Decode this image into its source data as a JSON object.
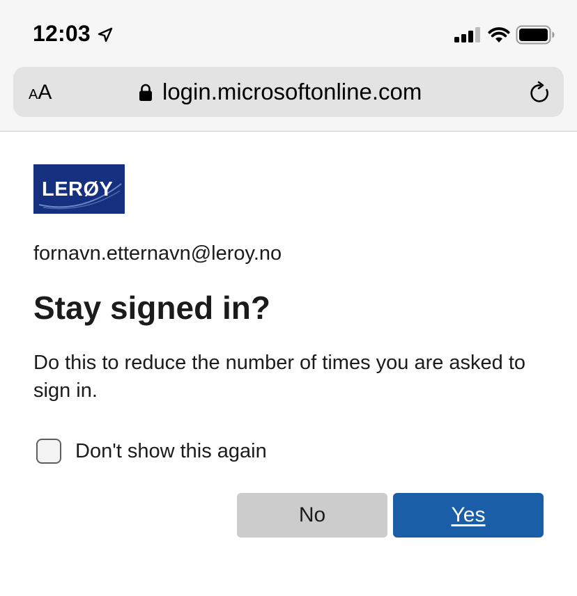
{
  "status_bar": {
    "time": "12:03",
    "icons": [
      "location-arrow-icon",
      "cellular-signal-icon",
      "wifi-icon",
      "battery-icon"
    ]
  },
  "browser": {
    "text_size_label_small": "A",
    "text_size_label_large": "A",
    "url": "login.microsoftonline.com",
    "icons": [
      "lock-icon",
      "reload-icon"
    ]
  },
  "logo": {
    "text": "LERØY",
    "background_color": "#15307e"
  },
  "account": {
    "email": "fornavn.etternavn@leroy.no"
  },
  "dialog": {
    "title": "Stay signed in?",
    "description": "Do this to reduce the number of times you are asked to sign in.",
    "checkbox_label": "Don't show this again",
    "checkbox_checked": false,
    "no_label": "No",
    "yes_label": "Yes"
  },
  "colors": {
    "primary_button": "#1a5ea8",
    "secondary_button": "#cccccc",
    "text": "#1b1b1b"
  }
}
